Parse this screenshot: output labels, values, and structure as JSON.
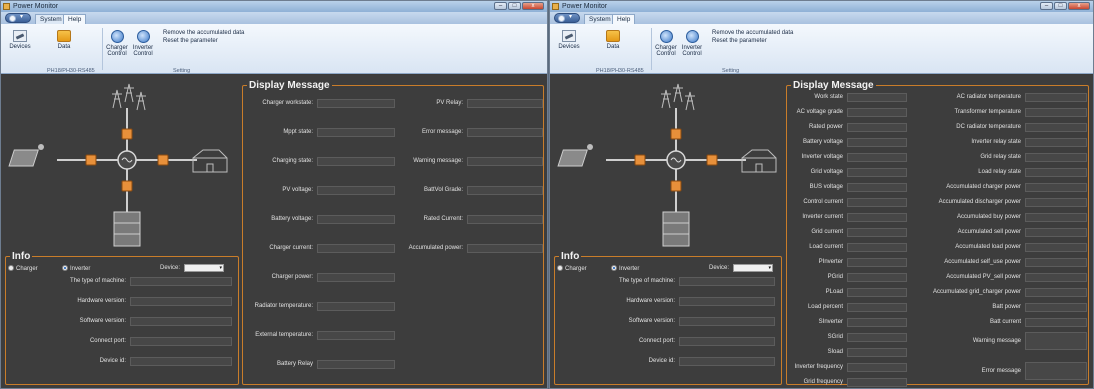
{
  "app": {
    "title": "Power Monitor",
    "menu_tabs": [
      "System",
      "Help"
    ]
  },
  "window_buttons": {
    "minimize": "–",
    "maximize": "□",
    "close": "x"
  },
  "ribbon": {
    "devices_label": "Devices",
    "data_label": "Data",
    "charger_control": "Charger Control",
    "inverter_control": "Inverter Control",
    "remove_label": "Remove the accumulated data",
    "reset_label": "Reset the parameter",
    "group_left": "PH18/PH30-RS485",
    "group_right": "Setting"
  },
  "info": {
    "title": "Info",
    "radio_charger": "Charger",
    "radio_inverter": "Inverter",
    "device_label": "Device:",
    "fields": [
      "The type of machine:",
      "Hardware version:",
      "Software version:",
      "Connect port:",
      "Device id:"
    ]
  },
  "display_title": "Display Message",
  "left_display": {
    "left_col": [
      "Charger workstate:",
      "Mppt state:",
      "Charging state:",
      "PV voltage:",
      "Battery voltage:",
      "Charger current:",
      "Charger power:",
      "Radiator temperature:",
      "External temperature:",
      "Battery Relay"
    ],
    "right_col": [
      "PV Relay:",
      "Error message:",
      "Warning message:",
      "BattVol Grade:",
      "Rated Current:",
      "Accumulated power:"
    ]
  },
  "right_display": {
    "left_col": [
      "Work state",
      "AC voltage grade",
      "Rated power",
      "Battery voltage",
      "Inverter voltage",
      "Grid voltage",
      "BUS voltage",
      "Control current",
      "Inverter current",
      "Grid current",
      "Load current",
      "PInverter",
      "PGrid",
      "PLoad",
      "Load percent",
      "SInverter",
      "SGrid",
      "Sload",
      "Inverter frequency",
      "Grid frequency"
    ],
    "right_col": [
      "AC radiator temperature",
      "Transformer temperature",
      "DC radiator temperature",
      "Inverter relay state",
      "Grid relay state",
      "Load relay state",
      "Accumulated charger power",
      "Accumulated discharger power",
      "Accumulated buy power",
      "Accumulated sell power",
      "Accumulated load power",
      "Accumulated self_use power",
      "Accumulated PV_sell power",
      "Accumulated grid_charger power",
      "Batt power",
      "Batt current"
    ],
    "warning": "Warning message",
    "error": "Error message"
  },
  "colors": {
    "accent": "#c97d2a",
    "background": "#3d3d3d",
    "field": "#474747",
    "node": "#e8903a"
  },
  "icons": [
    "pylon-icon",
    "solar-panel-icon",
    "inverter-icon",
    "house-icon",
    "battery-icon"
  ]
}
